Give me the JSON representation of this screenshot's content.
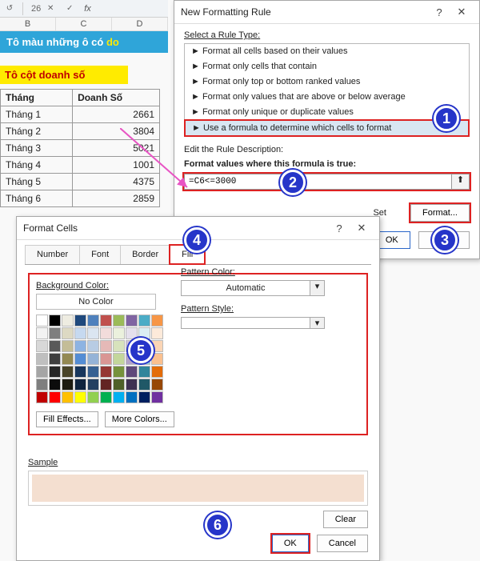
{
  "excel": {
    "fx_ref": "26",
    "col_headers": [
      "B",
      "C",
      "D"
    ],
    "title_vn_white": "Tô màu những ô có ",
    "title_vn_yellow": "do",
    "subtitle": "Tô cột doanh số",
    "table": {
      "headers": [
        "Tháng",
        "Doanh Số"
      ],
      "rows": [
        [
          "Tháng 1",
          "2661"
        ],
        [
          "Tháng 2",
          "3804"
        ],
        [
          "Tháng 3",
          "5021"
        ],
        [
          "Tháng 4",
          "1001"
        ],
        [
          "Tháng 5",
          "4375"
        ],
        [
          "Tháng 6",
          "2859"
        ]
      ]
    }
  },
  "rule_dialog": {
    "title": "New Formatting Rule",
    "select_label": "Select a Rule Type:",
    "options": [
      "► Format all cells based on their values",
      "► Format only cells that contain",
      "► Format only top or bottom ranked values",
      "► Format only values that are above or below average",
      "► Format only unique or duplicate values",
      "► Use a formula to determine which cells to format"
    ],
    "selected_index": 5,
    "edit_label": "Edit the Rule Description:",
    "formula_label": "Format values where this formula is true:",
    "formula_value": "=C6<=3000",
    "preview_set_label": "Set",
    "format_btn": "Format...",
    "ok": "OK",
    "cancel": "Cancel"
  },
  "format_dialog": {
    "title": "Format Cells",
    "tabs": [
      "Number",
      "Font",
      "Border",
      "Fill"
    ],
    "active_tab": 3,
    "bg_label": "Background Color:",
    "no_color": "No Color",
    "fill_effects": "Fill Effects...",
    "more_colors": "More Colors...",
    "pattern_color_label": "Pattern Color:",
    "pattern_color_value": "Automatic",
    "pattern_style_label": "Pattern Style:",
    "sample_label": "Sample",
    "clear": "Clear",
    "ok": "OK",
    "cancel": "Cancel",
    "palette": [
      "#ffffff",
      "#000000",
      "#eeece1",
      "#1f497d",
      "#4f81bd",
      "#c0504d",
      "#9bbb59",
      "#8064a2",
      "#4bacc6",
      "#f79646",
      "#f2f2f2",
      "#7f7f7f",
      "#ddd9c3",
      "#c6d9f0",
      "#dbe5f1",
      "#f2dcdb",
      "#ebf1dd",
      "#e5e0ec",
      "#dbeef3",
      "#fdeada",
      "#d8d8d8",
      "#595959",
      "#c4bd97",
      "#8db3e2",
      "#b8cce4",
      "#e5b9b7",
      "#d7e3bc",
      "#ccc1d9",
      "#b7dde8",
      "#fbd5b5",
      "#bfbfbf",
      "#3f3f3f",
      "#938953",
      "#548dd4",
      "#95b3d7",
      "#d99694",
      "#c3d69b",
      "#b2a2c7",
      "#92cddc",
      "#fac08f",
      "#a5a5a5",
      "#262626",
      "#494429",
      "#17365d",
      "#366092",
      "#953734",
      "#76923c",
      "#5f497a",
      "#31859b",
      "#e36c09",
      "#7f7f7f",
      "#0c0c0c",
      "#1d1b10",
      "#0f243e",
      "#244061",
      "#632423",
      "#4f6128",
      "#3f3151",
      "#205867",
      "#974806",
      "#c00000",
      "#ff0000",
      "#ffc000",
      "#ffff00",
      "#92d050",
      "#00b050",
      "#00b0f0",
      "#0070c0",
      "#002060",
      "#7030a0"
    ]
  },
  "badges": [
    "1",
    "2",
    "3",
    "4",
    "5",
    "6"
  ]
}
